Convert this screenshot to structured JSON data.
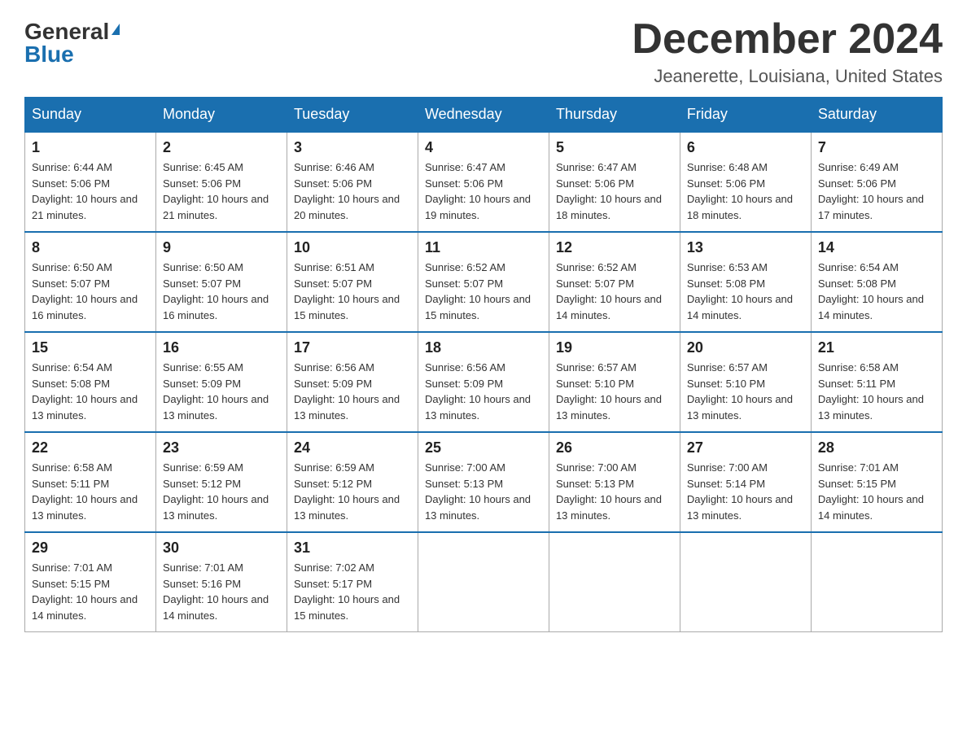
{
  "header": {
    "logo_general": "General",
    "logo_blue": "Blue",
    "month_title": "December 2024",
    "location": "Jeanerette, Louisiana, United States"
  },
  "weekdays": [
    "Sunday",
    "Monday",
    "Tuesday",
    "Wednesday",
    "Thursday",
    "Friday",
    "Saturday"
  ],
  "weeks": [
    [
      {
        "day": "1",
        "sunrise": "6:44 AM",
        "sunset": "5:06 PM",
        "daylight": "10 hours and 21 minutes."
      },
      {
        "day": "2",
        "sunrise": "6:45 AM",
        "sunset": "5:06 PM",
        "daylight": "10 hours and 21 minutes."
      },
      {
        "day": "3",
        "sunrise": "6:46 AM",
        "sunset": "5:06 PM",
        "daylight": "10 hours and 20 minutes."
      },
      {
        "day": "4",
        "sunrise": "6:47 AM",
        "sunset": "5:06 PM",
        "daylight": "10 hours and 19 minutes."
      },
      {
        "day": "5",
        "sunrise": "6:47 AM",
        "sunset": "5:06 PM",
        "daylight": "10 hours and 18 minutes."
      },
      {
        "day": "6",
        "sunrise": "6:48 AM",
        "sunset": "5:06 PM",
        "daylight": "10 hours and 18 minutes."
      },
      {
        "day": "7",
        "sunrise": "6:49 AM",
        "sunset": "5:06 PM",
        "daylight": "10 hours and 17 minutes."
      }
    ],
    [
      {
        "day": "8",
        "sunrise": "6:50 AM",
        "sunset": "5:07 PM",
        "daylight": "10 hours and 16 minutes."
      },
      {
        "day": "9",
        "sunrise": "6:50 AM",
        "sunset": "5:07 PM",
        "daylight": "10 hours and 16 minutes."
      },
      {
        "day": "10",
        "sunrise": "6:51 AM",
        "sunset": "5:07 PM",
        "daylight": "10 hours and 15 minutes."
      },
      {
        "day": "11",
        "sunrise": "6:52 AM",
        "sunset": "5:07 PM",
        "daylight": "10 hours and 15 minutes."
      },
      {
        "day": "12",
        "sunrise": "6:52 AM",
        "sunset": "5:07 PM",
        "daylight": "10 hours and 14 minutes."
      },
      {
        "day": "13",
        "sunrise": "6:53 AM",
        "sunset": "5:08 PM",
        "daylight": "10 hours and 14 minutes."
      },
      {
        "day": "14",
        "sunrise": "6:54 AM",
        "sunset": "5:08 PM",
        "daylight": "10 hours and 14 minutes."
      }
    ],
    [
      {
        "day": "15",
        "sunrise": "6:54 AM",
        "sunset": "5:08 PM",
        "daylight": "10 hours and 13 minutes."
      },
      {
        "day": "16",
        "sunrise": "6:55 AM",
        "sunset": "5:09 PM",
        "daylight": "10 hours and 13 minutes."
      },
      {
        "day": "17",
        "sunrise": "6:56 AM",
        "sunset": "5:09 PM",
        "daylight": "10 hours and 13 minutes."
      },
      {
        "day": "18",
        "sunrise": "6:56 AM",
        "sunset": "5:09 PM",
        "daylight": "10 hours and 13 minutes."
      },
      {
        "day": "19",
        "sunrise": "6:57 AM",
        "sunset": "5:10 PM",
        "daylight": "10 hours and 13 minutes."
      },
      {
        "day": "20",
        "sunrise": "6:57 AM",
        "sunset": "5:10 PM",
        "daylight": "10 hours and 13 minutes."
      },
      {
        "day": "21",
        "sunrise": "6:58 AM",
        "sunset": "5:11 PM",
        "daylight": "10 hours and 13 minutes."
      }
    ],
    [
      {
        "day": "22",
        "sunrise": "6:58 AM",
        "sunset": "5:11 PM",
        "daylight": "10 hours and 13 minutes."
      },
      {
        "day": "23",
        "sunrise": "6:59 AM",
        "sunset": "5:12 PM",
        "daylight": "10 hours and 13 minutes."
      },
      {
        "day": "24",
        "sunrise": "6:59 AM",
        "sunset": "5:12 PM",
        "daylight": "10 hours and 13 minutes."
      },
      {
        "day": "25",
        "sunrise": "7:00 AM",
        "sunset": "5:13 PM",
        "daylight": "10 hours and 13 minutes."
      },
      {
        "day": "26",
        "sunrise": "7:00 AM",
        "sunset": "5:13 PM",
        "daylight": "10 hours and 13 minutes."
      },
      {
        "day": "27",
        "sunrise": "7:00 AM",
        "sunset": "5:14 PM",
        "daylight": "10 hours and 13 minutes."
      },
      {
        "day": "28",
        "sunrise": "7:01 AM",
        "sunset": "5:15 PM",
        "daylight": "10 hours and 14 minutes."
      }
    ],
    [
      {
        "day": "29",
        "sunrise": "7:01 AM",
        "sunset": "5:15 PM",
        "daylight": "10 hours and 14 minutes."
      },
      {
        "day": "30",
        "sunrise": "7:01 AM",
        "sunset": "5:16 PM",
        "daylight": "10 hours and 14 minutes."
      },
      {
        "day": "31",
        "sunrise": "7:02 AM",
        "sunset": "5:17 PM",
        "daylight": "10 hours and 15 minutes."
      },
      null,
      null,
      null,
      null
    ]
  ],
  "labels": {
    "sunrise": "Sunrise:",
    "sunset": "Sunset:",
    "daylight": "Daylight:"
  }
}
